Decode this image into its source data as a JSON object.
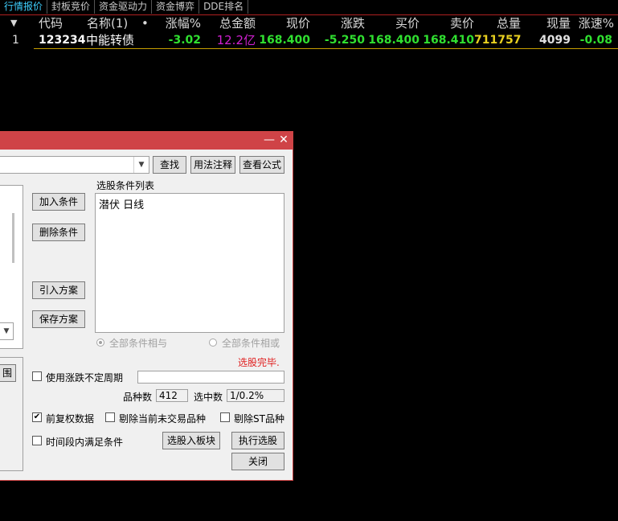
{
  "tabs": [
    "行情报价",
    "封板竞价",
    "资金驱动力",
    "资金博弈",
    "DDE排名"
  ],
  "header": {
    "sort_arrow": "▼",
    "columns": [
      "代码",
      "名称(1)",
      "•",
      "涨幅%",
      "总金额",
      "现价",
      "涨跌",
      "买价",
      "卖价",
      "总量",
      "现量",
      "涨速%"
    ]
  },
  "row": {
    "index": "1",
    "code": "123234",
    "name": "中能转债",
    "change_pct": "-3.02",
    "amount": "12.2亿",
    "price": "168.400",
    "change": "-5.250",
    "bid": "168.400",
    "ask": "168.410",
    "volume": "711757",
    "cur_vol": "4099",
    "speed": "-0.08"
  },
  "dialog": {
    "minimize": "—",
    "close": "✕",
    "combo_arrow": "▼",
    "find": "查找",
    "usage": "用法注释",
    "formula": "查看公式",
    "list_title": "选股条件列表",
    "list_items": [
      "潜伏 日线"
    ],
    "add": "加入条件",
    "delete": "删除条件",
    "import": "引入方案",
    "save": "保存方案",
    "radio_and": "全部条件相与",
    "radio_or": "全部条件相或",
    "status": "选股完毕.",
    "range_btn": "围",
    "use_period": "使用涨跌不定周期",
    "count_label": "品种数",
    "count_value": "412",
    "selected_label": "选中数",
    "selected_value": "1/0.2%",
    "pre_adjust": "前复权数据",
    "exclude_untraded": "剔除当前未交易品种",
    "exclude_st": "剔除ST品种",
    "time_range": "时间段内满足条件",
    "to_block": "选股入板块",
    "execute": "执行选股",
    "close_btn": "关闭"
  },
  "colors": {
    "up": "#ff3a3a",
    "down": "#30e030",
    "amount": "#d020d0",
    "volume": "#e8d020",
    "code": "#ffffff",
    "active_tab": "#3fd0ff"
  }
}
